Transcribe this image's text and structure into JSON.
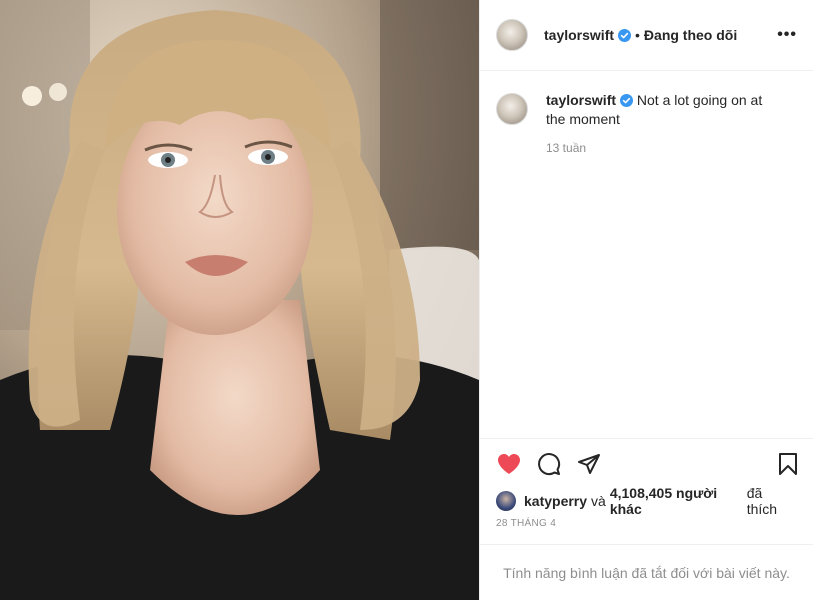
{
  "header": {
    "username": "taylorswift",
    "separator": "•",
    "follow_status": "Đang theo dõi",
    "more_label": "•••"
  },
  "caption": {
    "username": "taylorswift",
    "text": "Not a lot going on at the moment",
    "time_ago": "13 tuần"
  },
  "actions": {
    "like_icon": "heart-filled-icon",
    "comment_icon": "comment-icon",
    "share_icon": "share-icon",
    "save_icon": "bookmark-icon",
    "like_color": "#ed4956"
  },
  "likes": {
    "liker": "katyperry",
    "connector": "và",
    "others": "4,108,405 người khác",
    "suffix": "đã thích"
  },
  "date": "28 THÁNG 4",
  "comments_notice": "Tính năng bình luận đã tắt đối với bài viết này.",
  "colors": {
    "verified": "#3897f0",
    "muted": "#8e8e8e",
    "text": "#262626"
  }
}
